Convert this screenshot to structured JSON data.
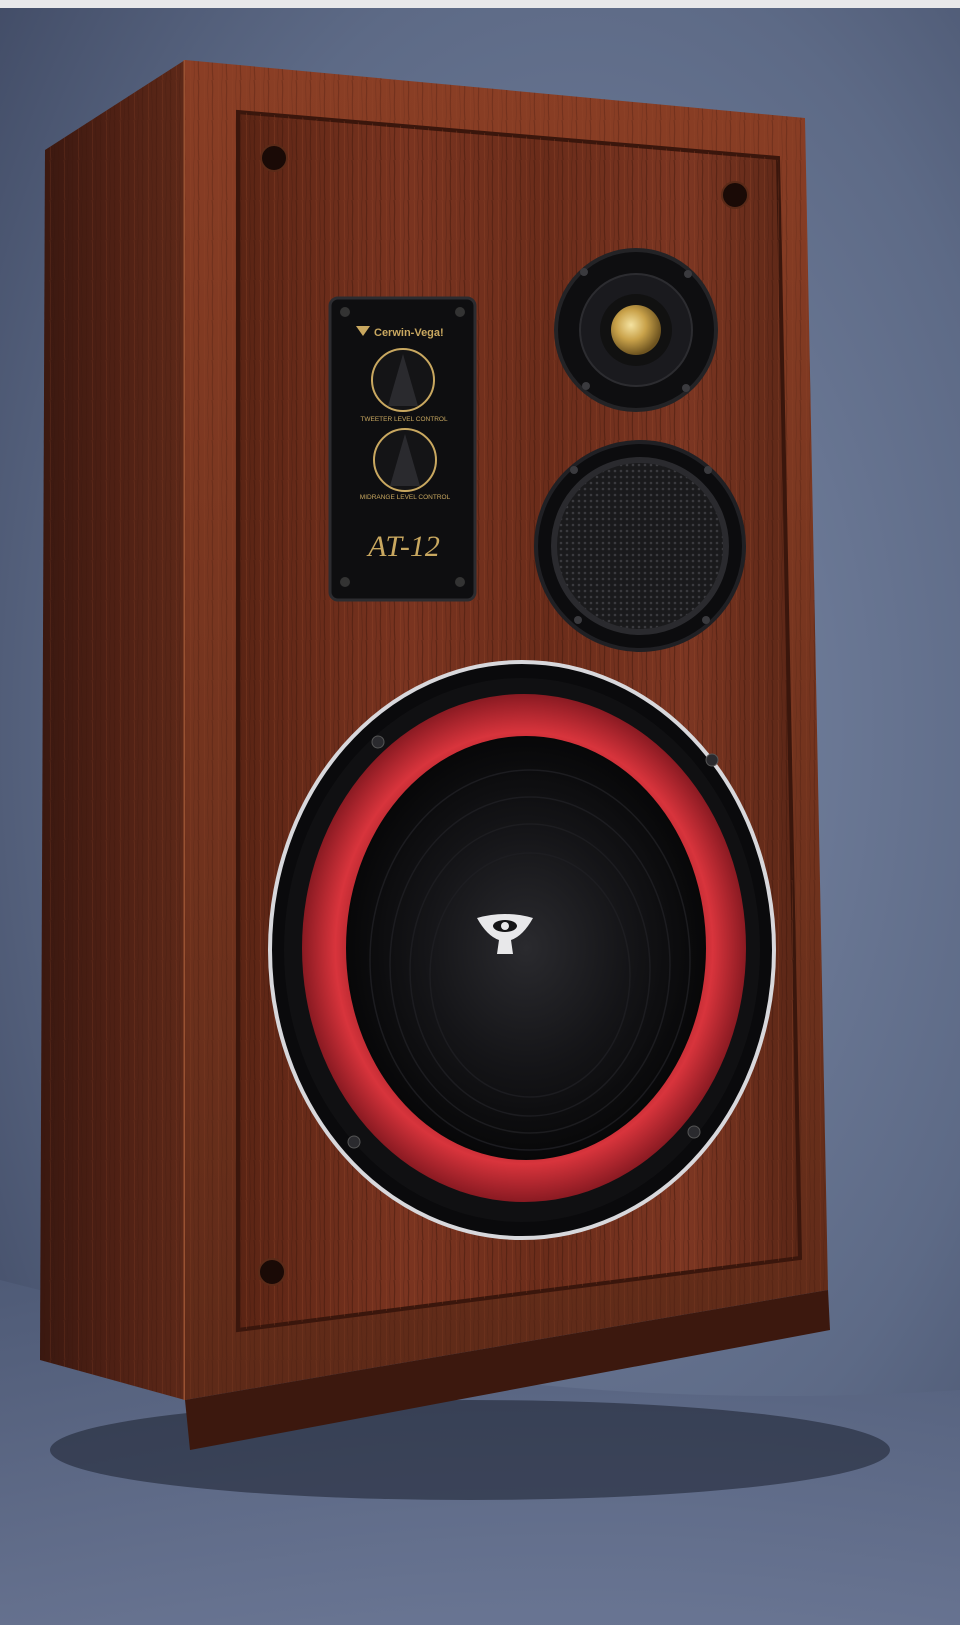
{
  "product": {
    "brand_label": "Cerwin-Vega!",
    "model_label": "AT-12",
    "control_tweeter_label": "TWEETER LEVEL CONTROL",
    "control_midrange_label": "MIDRANGE LEVEL CONTROL"
  },
  "colors": {
    "backdrop": "#5d6a86",
    "wood_dark": "#3a1a10",
    "wood_mid": "#6a2e1b",
    "wood_light": "#8a3e25",
    "woofer_surround": "#c8323a",
    "chrome_ring": "#d8d8dc",
    "panel_gold": "#c9a860"
  },
  "icons": [
    "cerwin-vega-logo-icon"
  ]
}
